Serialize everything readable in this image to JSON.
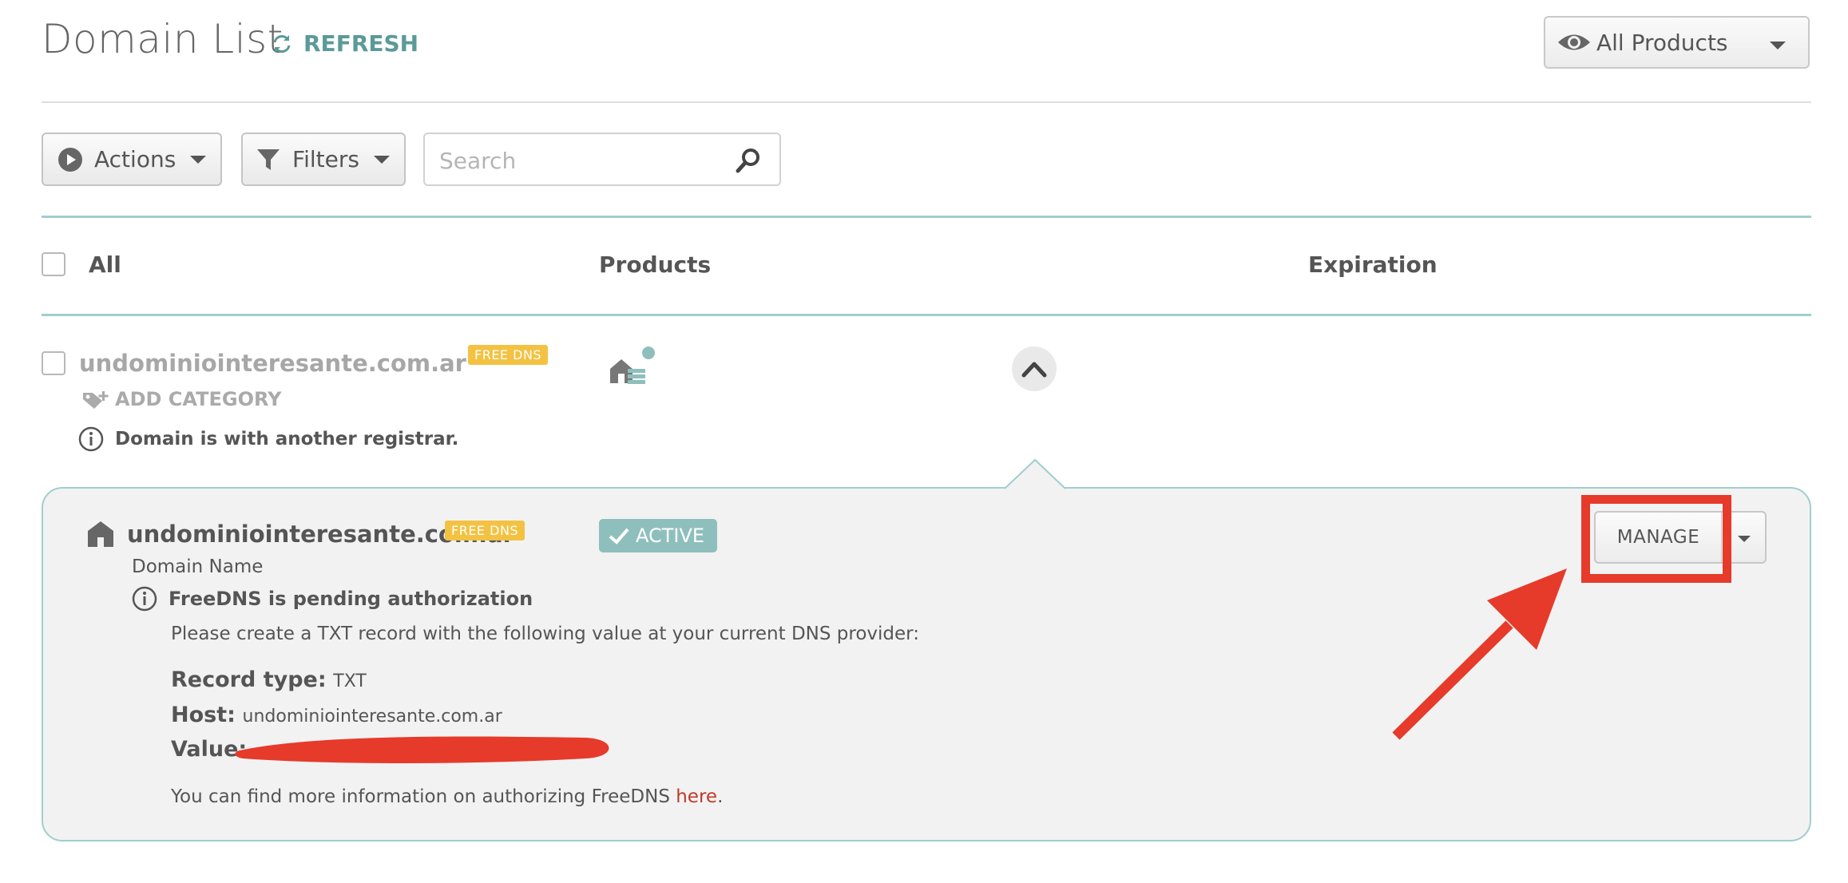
{
  "header": {
    "title": "Domain List",
    "refresh_label": "REFRESH",
    "product_filter": "All Products"
  },
  "toolbar": {
    "actions_label": "Actions",
    "filters_label": "Filters",
    "search_placeholder": "Search"
  },
  "table": {
    "columns": [
      "All",
      "Products",
      "Expiration"
    ]
  },
  "row": {
    "domain": "undominiointeresante.com.ar",
    "badge": "FREE DNS",
    "add_category": "ADD CATEGORY",
    "info": "Domain is with another registrar."
  },
  "panel": {
    "domain": "undominiointeresante.com.ar",
    "badge": "FREE DNS",
    "status": "ACTIVE",
    "domain_label": "Domain Name",
    "pending_title": "FreeDNS is pending authorization",
    "instructions": "Please create a TXT record with the following value at your current DNS provider:",
    "record_type_label": "Record type:",
    "record_type_value": "TXT",
    "host_label": "Host:",
    "host_value": "undominiointeresante.com.ar",
    "value_label": "Value:",
    "more_info_prefix": "You can find more information on authorizing FreeDNS ",
    "more_info_link": "here",
    "more_info_suffix": ".",
    "manage_label": "MANAGE"
  },
  "colors": {
    "accent_teal": "#5b9a98",
    "border_teal": "#9fcfcc",
    "badge_yellow": "#f3c242",
    "annotation_red": "#e63a2b",
    "link_red": "#c0392b"
  },
  "icons": [
    "refresh-icon",
    "eye-icon",
    "play-icon",
    "filter-icon",
    "search-icon",
    "dns-house-icon",
    "tag-add-icon",
    "info-icon",
    "chevron-up-icon",
    "home-icon",
    "check-icon",
    "caret-down-icon"
  ]
}
